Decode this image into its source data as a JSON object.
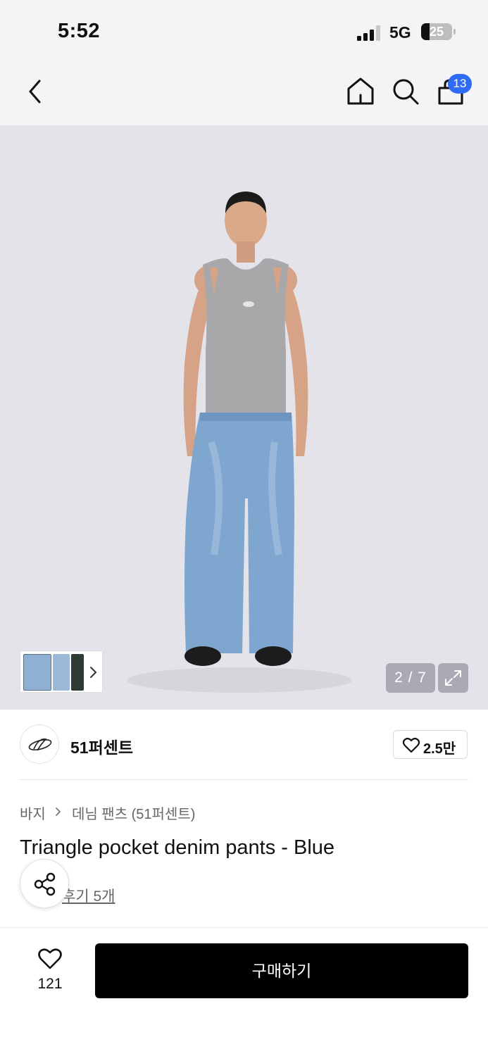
{
  "status_bar": {
    "time": "5:52",
    "network": "5G",
    "battery": "25"
  },
  "nav": {
    "back_icon": "chevron-left-icon",
    "home_icon": "home-icon",
    "search_icon": "search-icon",
    "cart_icon": "shopping-bag-icon",
    "cart_badge": "13",
    "badge_color": "#2f6cf6"
  },
  "gallery": {
    "counter": "2 / 7",
    "thumb_next_icon": "chevron-right-icon",
    "expand_icon": "expand-icon"
  },
  "brand": {
    "name": "51퍼센트",
    "likes": "2.5만",
    "heart_icon": "heart-icon"
  },
  "product": {
    "breadcrumb": [
      "바지",
      "데님 팬츠 (51퍼센트)"
    ],
    "title": "Triangle pocket denim pants - Blue",
    "review_text": "후기 5개",
    "share_icon": "share-icon"
  },
  "bottom_bar": {
    "wish_count": "121",
    "buy_label": "구매하기"
  }
}
